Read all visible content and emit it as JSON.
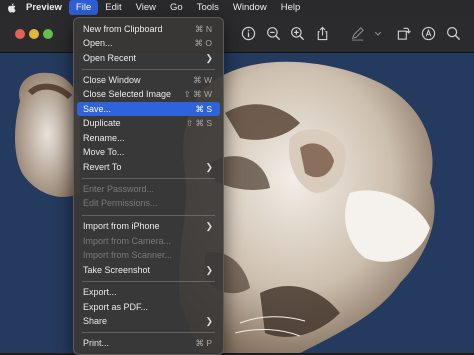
{
  "menubar": {
    "app": "Preview",
    "items": [
      "File",
      "Edit",
      "View",
      "Go",
      "Tools",
      "Window",
      "Help"
    ]
  },
  "file_menu": {
    "items": [
      {
        "label": "New from Clipboard",
        "shortcut": "⌘ N"
      },
      {
        "label": "Open...",
        "shortcut": "⌘ O"
      },
      {
        "label": "Open Recent",
        "submenu": true
      },
      {
        "label": "Close Window",
        "shortcut": "⌘ W"
      },
      {
        "label": "Close Selected Image",
        "shortcut": "⇧ ⌘ W"
      },
      {
        "label": "Save...",
        "shortcut": "⌘ S",
        "highlighted": true
      },
      {
        "label": "Duplicate",
        "shortcut": "⇧ ⌘ S"
      },
      {
        "label": "Rename..."
      },
      {
        "label": "Move To..."
      },
      {
        "label": "Revert To",
        "submenu": true
      },
      {
        "label": "Enter Password...",
        "disabled": true
      },
      {
        "label": "Edit Permissions...",
        "disabled": true
      },
      {
        "label": "Import from iPhone",
        "submenu": true
      },
      {
        "label": "Import from Camera...",
        "disabled": true
      },
      {
        "label": "Import from Scanner...",
        "disabled": true
      },
      {
        "label": "Take Screenshot",
        "submenu": true
      },
      {
        "label": "Export..."
      },
      {
        "label": "Export as PDF..."
      },
      {
        "label": "Share",
        "submenu": true
      },
      {
        "label": "Print...",
        "shortcut": "⌘ P"
      }
    ]
  },
  "colors": {
    "accent": "#2f63dc",
    "canvas": "#243a5e"
  }
}
